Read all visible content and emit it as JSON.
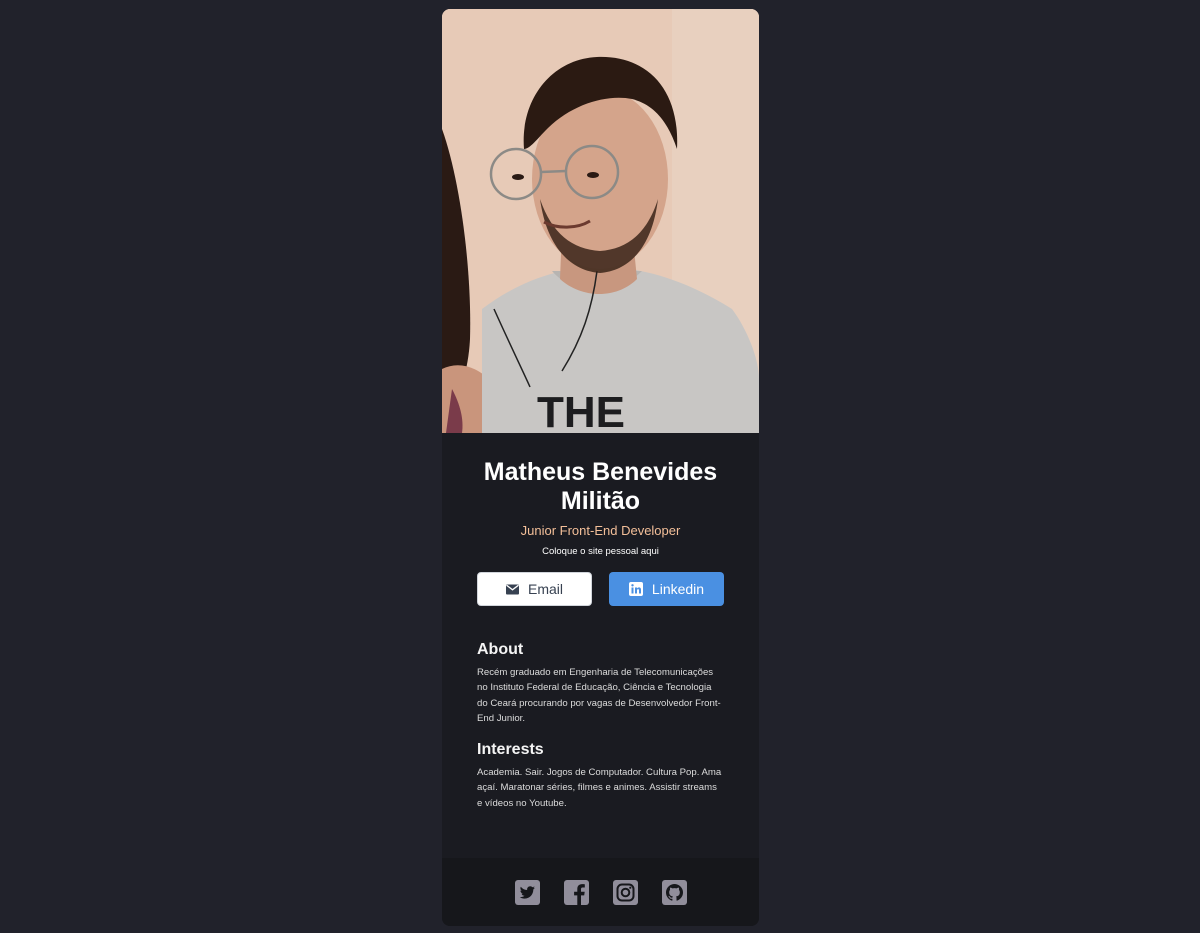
{
  "profile": {
    "photo_alt": "Matheus Benevides Militão",
    "name": "Matheus Benevides Militão",
    "role": "Junior Front-End Developer",
    "website": "Coloque o site pessoal aqui"
  },
  "buttons": {
    "email_label": "Email",
    "linkedin_label": "Linkedin"
  },
  "about": {
    "heading": "About",
    "text": "Recém graduado em Engenharia de Telecomunicações no Instituto Federal de Educação, Ciência e Tecnologia do Ceará procurando por vagas de Desenvolvedor Front-End Junior."
  },
  "interests": {
    "heading": "Interests",
    "text": "Academia. Sair. Jogos de Computador. Cultura Pop. Ama açaí. Maratonar séries, filmes e animes. Assistir streams e vídeos no Youtube."
  },
  "footer": {
    "icons": [
      "twitter-icon",
      "facebook-icon",
      "instagram-icon",
      "github-icon"
    ]
  },
  "colors": {
    "page_bg": "#21222b",
    "card_bg": "#1a1b21",
    "footer_bg": "#16171b",
    "accent": "#f3bf99",
    "linkedin_blue": "#4a90e2",
    "social_icon": "#918e9b"
  }
}
